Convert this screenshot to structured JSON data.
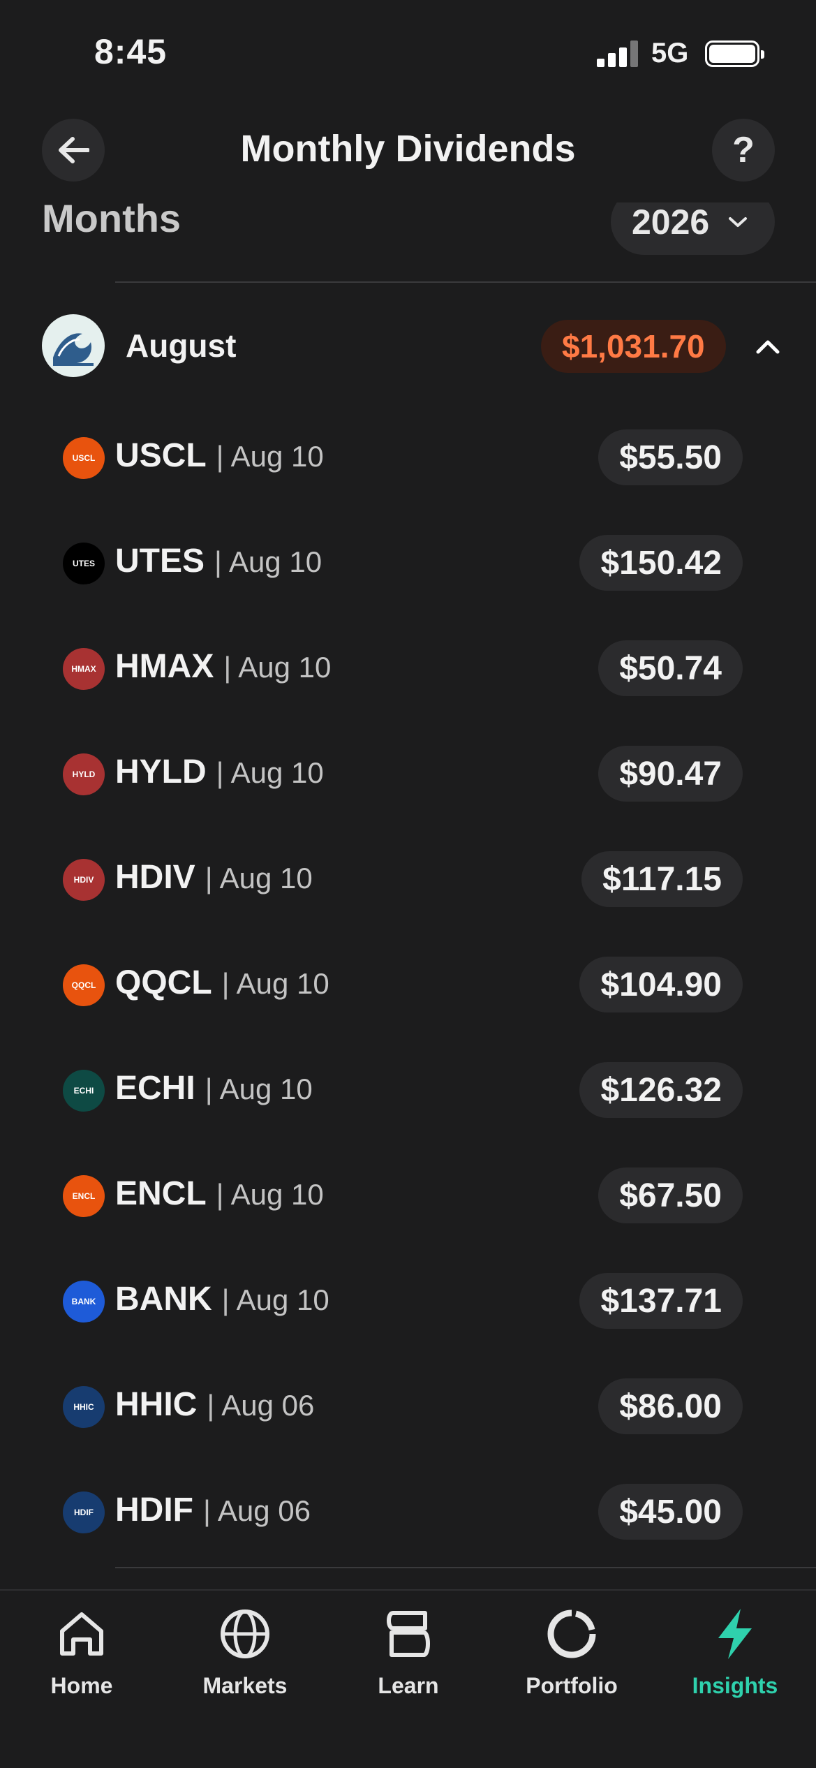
{
  "status_bar": {
    "time": "8:45",
    "network": "5G"
  },
  "header": {
    "title": "Monthly Dividends",
    "help_label": "?"
  },
  "filter": {
    "label": "Months",
    "year": "2026"
  },
  "month": {
    "name": "August",
    "total": "$1,031.70"
  },
  "dividends": [
    {
      "ticker": "USCL",
      "date": "Aug 10",
      "amount": "$55.50",
      "logo_text": "USCL",
      "logo_color": "#e8530e"
    },
    {
      "ticker": "UTES",
      "date": "Aug 10",
      "amount": "$150.42",
      "logo_text": "UTES",
      "logo_color": "#000000"
    },
    {
      "ticker": "HMAX",
      "date": "Aug 10",
      "amount": "$50.74",
      "logo_text": "HMAX",
      "logo_color": "#a83232"
    },
    {
      "ticker": "HYLD",
      "date": "Aug 10",
      "amount": "$90.47",
      "logo_text": "HYLD",
      "logo_color": "#a83232"
    },
    {
      "ticker": "HDIV",
      "date": "Aug 10",
      "amount": "$117.15",
      "logo_text": "HDIV",
      "logo_color": "#a83232"
    },
    {
      "ticker": "QQCL",
      "date": "Aug 10",
      "amount": "$104.90",
      "logo_text": "QQCL",
      "logo_color": "#e8530e"
    },
    {
      "ticker": "ECHI",
      "date": "Aug 10",
      "amount": "$126.32",
      "logo_text": "ECHI",
      "logo_color": "#0e4a44"
    },
    {
      "ticker": "ENCL",
      "date": "Aug 10",
      "amount": "$67.50",
      "logo_text": "ENCL",
      "logo_color": "#e8530e"
    },
    {
      "ticker": "BANK",
      "date": "Aug 10",
      "amount": "$137.71",
      "logo_text": "BANK",
      "logo_color": "#1e5bd8"
    },
    {
      "ticker": "HHIC",
      "date": "Aug 06",
      "amount": "$86.00",
      "logo_text": "HHIC",
      "logo_color": "#173c70"
    },
    {
      "ticker": "HDIF",
      "date": "Aug 06",
      "amount": "$45.00",
      "logo_text": "HDIF",
      "logo_color": "#173c70"
    }
  ],
  "tabs": [
    {
      "label": "Home",
      "icon": "home-icon"
    },
    {
      "label": "Markets",
      "icon": "globe-icon"
    },
    {
      "label": "Learn",
      "icon": "learn-icon"
    },
    {
      "label": "Portfolio",
      "icon": "portfolio-icon"
    },
    {
      "label": "Insights",
      "icon": "lightning-icon",
      "active": true
    }
  ],
  "colors": {
    "accent": "#2fd1ad",
    "total_text": "#ff7a45",
    "total_bg": "#3a1d14",
    "background": "#1c1c1d"
  }
}
